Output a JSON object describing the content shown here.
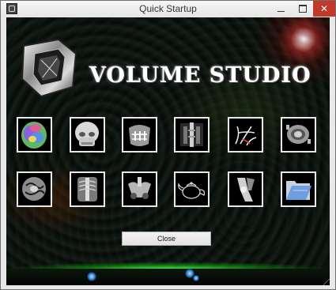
{
  "window": {
    "title": "Quick Startup"
  },
  "controls": {
    "minimize_icon": "minimize-icon",
    "maximize_icon": "maximize-icon",
    "close_icon": "close-icon",
    "close_glyph": "✕"
  },
  "logo": {
    "title": "VOLUME STUDIO",
    "icon": "volume-cube-logo"
  },
  "tiles": [
    {
      "id": "ct-head-color",
      "icon": "ct-head-color-thumbnail"
    },
    {
      "id": "skull",
      "icon": "skull-thumbnail"
    },
    {
      "id": "dental-scan",
      "icon": "dental-scan-thumbnail"
    },
    {
      "id": "spine-scan",
      "icon": "spine-scan-thumbnail"
    },
    {
      "id": "vessels",
      "icon": "vessels-thumbnail"
    },
    {
      "id": "engine-part",
      "icon": "engine-part-thumbnail"
    },
    {
      "id": "brain-slice",
      "icon": "brain-slice-thumbnail"
    },
    {
      "id": "torso-scan",
      "icon": "torso-scan-thumbnail"
    },
    {
      "id": "pelvis-scan",
      "icon": "pelvis-scan-thumbnail"
    },
    {
      "id": "teapot",
      "icon": "teapot-thumbnail"
    },
    {
      "id": "leg-scan",
      "icon": "leg-scan-thumbnail"
    },
    {
      "id": "open-folder",
      "icon": "open-folder-icon"
    }
  ],
  "buttons": {
    "close_label": "Close"
  },
  "colors": {
    "accent_glow": "#3cff3c",
    "titlebar_close": "#c0392b",
    "background": "#080a08"
  }
}
